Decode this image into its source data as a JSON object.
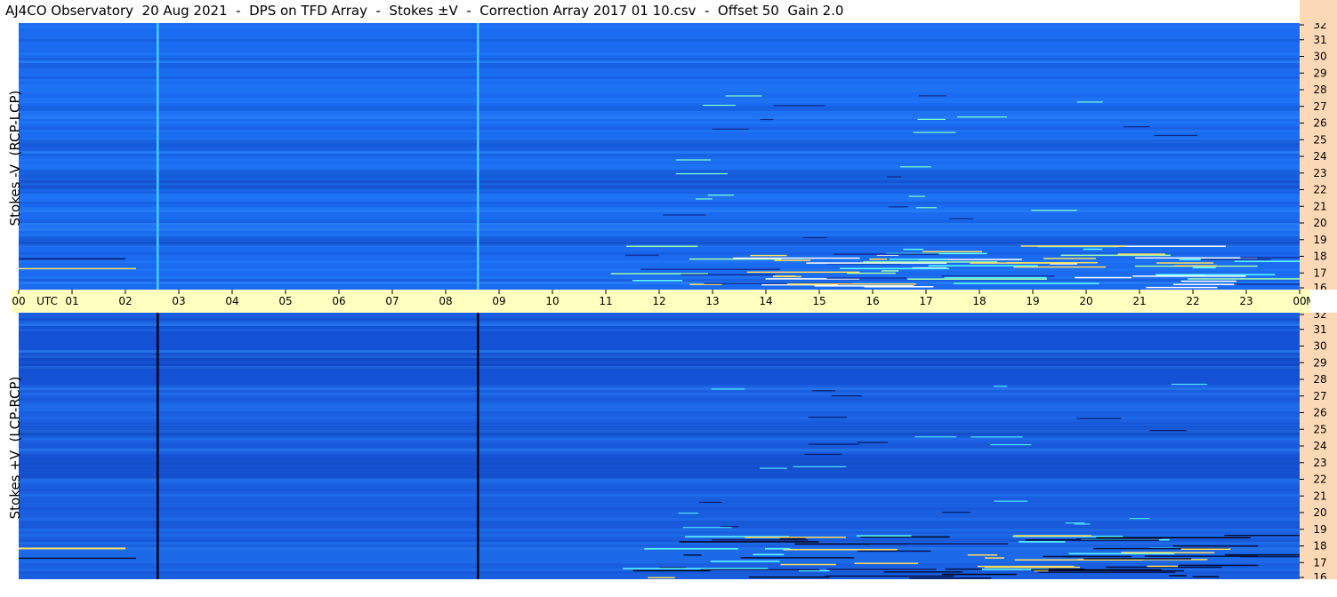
{
  "title": "AJ4CO Observatory  20 Aug 2021  -  DPS on TFD Array  -  Stokes ±V  -  Correction Array 2017 01 10.csv  -  Offset 50  Gain 2.0",
  "chart_data": [
    {
      "type": "heatmap",
      "ylabel": "Stokes -V  (RCP-LCP)",
      "x_ticks": [
        "00",
        "UTC",
        "01",
        "02",
        "03",
        "04",
        "05",
        "06",
        "07",
        "08",
        "09",
        "10",
        "11",
        "12",
        "13",
        "14",
        "15",
        "16",
        "17",
        "18",
        "19",
        "20",
        "21",
        "22",
        "23",
        "00",
        "MHz"
      ],
      "y_ticks": [
        32,
        31,
        30,
        29,
        28,
        27,
        26,
        25,
        24,
        23,
        22,
        21,
        20,
        19,
        18,
        17,
        16
      ],
      "xlim_hours": [
        0,
        24
      ],
      "ylim_mhz": [
        16,
        32
      ],
      "colormap_base": "#1a6bf0",
      "vertical_markers_hours": [
        2.6,
        8.6
      ],
      "marker_color": "#3fd0ff"
    },
    {
      "type": "heatmap",
      "ylabel": "Stokes +V  (LCP-RCP)",
      "y_ticks": [
        32,
        31,
        30,
        29,
        28,
        27,
        26,
        25,
        24,
        23,
        22,
        21,
        20,
        19,
        18,
        17,
        16
      ],
      "xlim_hours": [
        0,
        24
      ],
      "ylim_mhz": [
        16,
        32
      ],
      "colormap_base": "#1a5fe0",
      "vertical_markers_hours": [
        2.6,
        8.6
      ],
      "marker_color": "#000000"
    }
  ],
  "colors": {
    "time_axis_bg": "#ffffc0",
    "freq_axis_bg": "#fcd9b6"
  }
}
